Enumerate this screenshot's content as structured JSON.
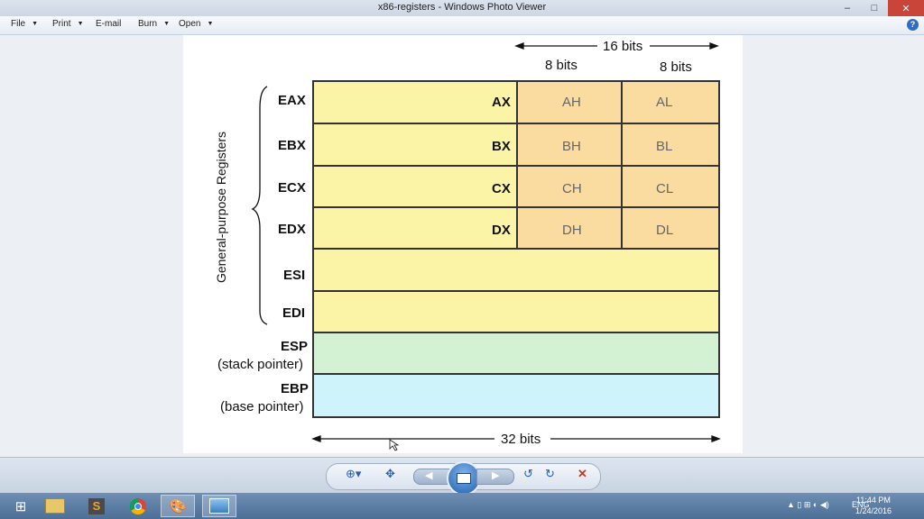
{
  "window": {
    "title": "x86-registers - Windows Photo Viewer",
    "minimize_glyph": "–",
    "maximize_glyph": "□",
    "close_glyph": "✕"
  },
  "menu": {
    "items": [
      "File",
      "Print",
      "E-mail",
      "Burn",
      "Open"
    ],
    "help_glyph": "?"
  },
  "diagram": {
    "side_label": "General-purpose Registers",
    "sixteen_bits": "16 bits",
    "eight_bits_left": "8 bits",
    "eight_bits_right": "8 bits",
    "thirtytwo_bits": "32 bits",
    "registers": {
      "eax": "EAX",
      "ebx": "EBX",
      "ecx": "ECX",
      "edx": "EDX",
      "esi": "ESI",
      "edi": "EDI",
      "esp": "ESP",
      "esp_sub": "(stack pointer)",
      "ebp": "EBP",
      "ebp_sub": "(base pointer)"
    },
    "sub16": {
      "ax": "AX",
      "bx": "BX",
      "cx": "CX",
      "dx": "DX"
    },
    "high8": {
      "ah": "AH",
      "bh": "BH",
      "ch": "CH",
      "dh": "DH"
    },
    "low8": {
      "al": "AL",
      "bl": "BL",
      "cl": "CL",
      "dl": "DL"
    },
    "colors": {
      "yellow": "#fbf4a6",
      "orange": "#fbdca0",
      "green": "#d3f1d3",
      "cyan": "#cff3fb"
    }
  },
  "taskbar": {
    "language": "ENG",
    "time": "11:44 PM",
    "date": "1/24/2016"
  }
}
